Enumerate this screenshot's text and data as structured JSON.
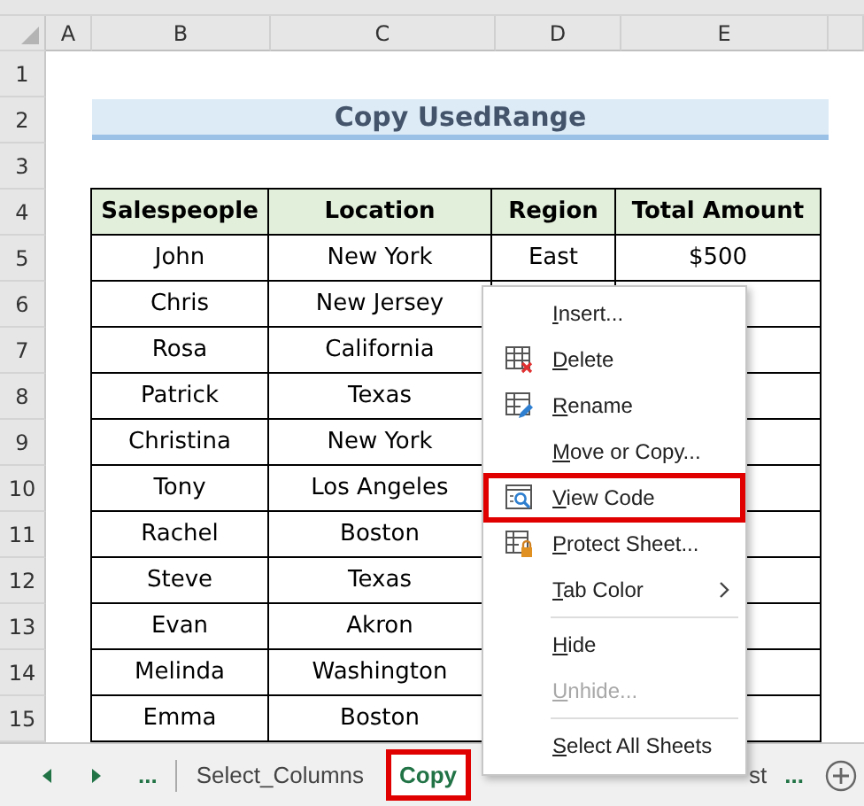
{
  "columns": [
    "A",
    "B",
    "C",
    "D",
    "E"
  ],
  "row_numbers": [
    "1",
    "2",
    "3",
    "4",
    "5",
    "6",
    "7",
    "8",
    "9",
    "10",
    "11",
    "12",
    "13",
    "14",
    "15"
  ],
  "title": "Copy UsedRange",
  "table": {
    "headers": [
      "Salespeople",
      "Location",
      "Region",
      "Total Amount"
    ],
    "rows": [
      {
        "salesperson": "John",
        "location": "New York",
        "region": "East",
        "amount": "$500"
      },
      {
        "salesperson": "Chris",
        "location": "New Jersey"
      },
      {
        "salesperson": "Rosa",
        "location": "California"
      },
      {
        "salesperson": "Patrick",
        "location": "Texas"
      },
      {
        "salesperson": "Christina",
        "location": "New York"
      },
      {
        "salesperson": "Tony",
        "location": "Los Angeles"
      },
      {
        "salesperson": "Rachel",
        "location": "Boston"
      },
      {
        "salesperson": "Steve",
        "location": "Texas"
      },
      {
        "salesperson": "Evan",
        "location": "Akron"
      },
      {
        "salesperson": "Melinda",
        "location": "Washington"
      },
      {
        "salesperson": "Emma",
        "location": "Boston"
      }
    ]
  },
  "context_menu": [
    {
      "kind": "plain",
      "label": "Insert...",
      "disabled": false,
      "annotated": false,
      "submenu": false
    },
    {
      "kind": "delete",
      "label": "Delete",
      "disabled": false,
      "annotated": false,
      "submenu": false
    },
    {
      "kind": "rename",
      "label": "Rename",
      "disabled": false,
      "annotated": false,
      "submenu": false
    },
    {
      "kind": "plain",
      "label": "Move or Copy...",
      "disabled": false,
      "annotated": false,
      "submenu": false
    },
    {
      "kind": "view",
      "label": "View Code",
      "disabled": false,
      "annotated": true,
      "submenu": false
    },
    {
      "kind": "protect",
      "label": "Protect Sheet...",
      "disabled": false,
      "annotated": false,
      "submenu": false
    },
    {
      "kind": "plain",
      "label": "Tab Color",
      "disabled": false,
      "annotated": false,
      "submenu": true
    },
    {
      "kind": "separator"
    },
    {
      "kind": "plain",
      "label": "Hide",
      "disabled": false,
      "annotated": false,
      "submenu": false
    },
    {
      "kind": "plain",
      "label": "Unhide...",
      "disabled": true,
      "annotated": false,
      "submenu": false
    },
    {
      "kind": "separator"
    },
    {
      "kind": "plain",
      "label": "Select All Sheets",
      "disabled": false,
      "annotated": false,
      "submenu": false
    }
  ],
  "sheet_tabs": {
    "overflow_left": "...",
    "tabs": [
      {
        "label": "Select_Columns",
        "selected": false,
        "annotated": false
      },
      {
        "label": "Copy",
        "selected": true,
        "annotated": true
      }
    ],
    "cut_tab": "st",
    "overflow_right": "..."
  }
}
